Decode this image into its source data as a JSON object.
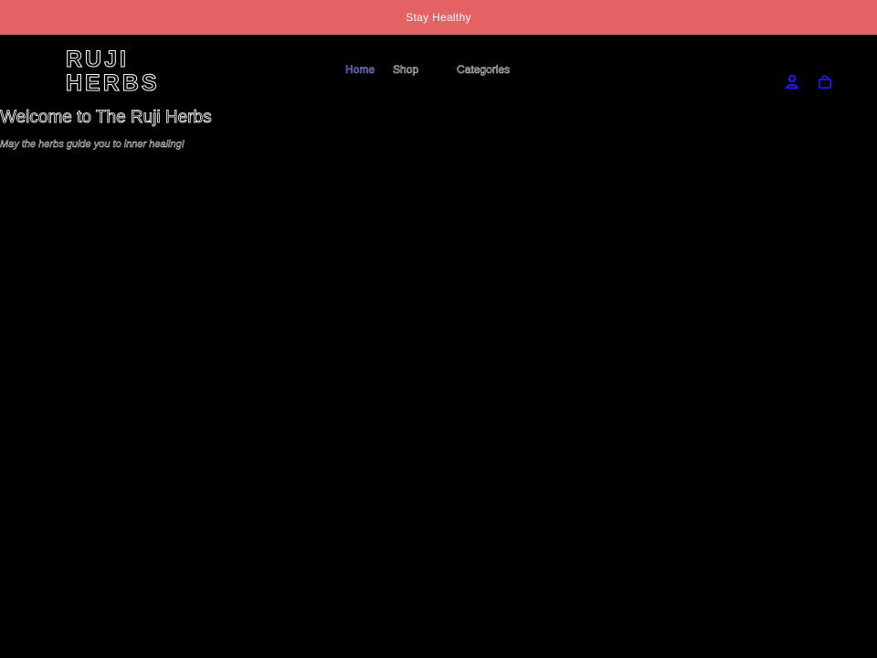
{
  "announcement": {
    "text": "Stay Healthy",
    "background": "#e46264"
  },
  "header": {
    "logo_lines": [
      "RUJI",
      "HERBS"
    ],
    "nav": [
      {
        "label": "Home",
        "active": true
      },
      {
        "label": "Shop",
        "active": false
      },
      {
        "label": "Categories",
        "active": false
      }
    ],
    "icons": [
      "account-icon",
      "cart-icon"
    ],
    "icon_color": "#1a1aff"
  },
  "hero": {
    "title": "Welcome to The Ruji Herbs",
    "subtitle": "May the herbs guide you to inner healing!"
  }
}
